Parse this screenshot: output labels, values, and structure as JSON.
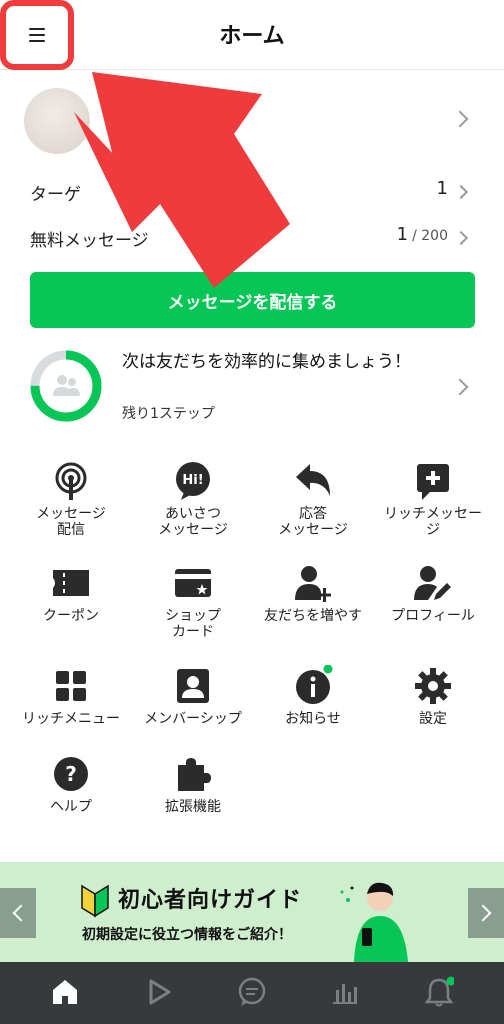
{
  "header": {
    "title": "ホーム",
    "menu_icon": "hamburger-menu-icon"
  },
  "stats": [
    {
      "label": "ターゲ",
      "value": "1",
      "suffix": ""
    },
    {
      "label": "無料メッセージ",
      "value": "1",
      "suffix": "/ 200"
    }
  ],
  "send_button": {
    "label": "メッセージを配信する"
  },
  "progress": {
    "title": "次は友だちを効率的に集めましょう！",
    "subtitle": "残り1ステップ",
    "completed_fraction": 0.75
  },
  "grid": [
    {
      "label": "メッセージ\n配信",
      "icon": "broadcast-icon"
    },
    {
      "label": "あいさつ\nメッセージ",
      "icon": "hi-greeting-icon"
    },
    {
      "label": "応答\nメッセージ",
      "icon": "reply-arrow-icon"
    },
    {
      "label": "リッチメッセー\nジ",
      "icon": "rich-message-plus-icon"
    },
    {
      "label": "クーポン",
      "icon": "coupon-icon"
    },
    {
      "label": "ショップ\nカード",
      "icon": "shop-card-icon"
    },
    {
      "label": "友だちを増やす",
      "icon": "add-friend-icon"
    },
    {
      "label": "プロフィール",
      "icon": "profile-edit-icon"
    },
    {
      "label": "リッチメニュー",
      "icon": "rich-menu-icon"
    },
    {
      "label": "メンバーシップ",
      "icon": "membership-icon"
    },
    {
      "label": "お知らせ",
      "icon": "info-notice-icon"
    },
    {
      "label": "設定",
      "icon": "gear-icon"
    },
    {
      "label": "ヘルプ",
      "icon": "help-icon"
    },
    {
      "label": "拡張機能",
      "icon": "puzzle-extension-icon"
    }
  ],
  "banner": {
    "title": "初心者向けガイド",
    "subtitle": "初期設定に役立つ情報をご紹介！"
  },
  "tabs": [
    {
      "icon": "home-icon",
      "active": true
    },
    {
      "icon": "play-icon",
      "active": false
    },
    {
      "icon": "chat-icon",
      "active": false
    },
    {
      "icon": "bar-chart-icon",
      "active": false
    },
    {
      "icon": "bell-icon",
      "active": false
    }
  ],
  "colors": {
    "brand_green": "#06c755",
    "annotation_red": "#ef3b3b",
    "tabbar_bg": "#373a3c",
    "notify_dot": "#06c755"
  }
}
